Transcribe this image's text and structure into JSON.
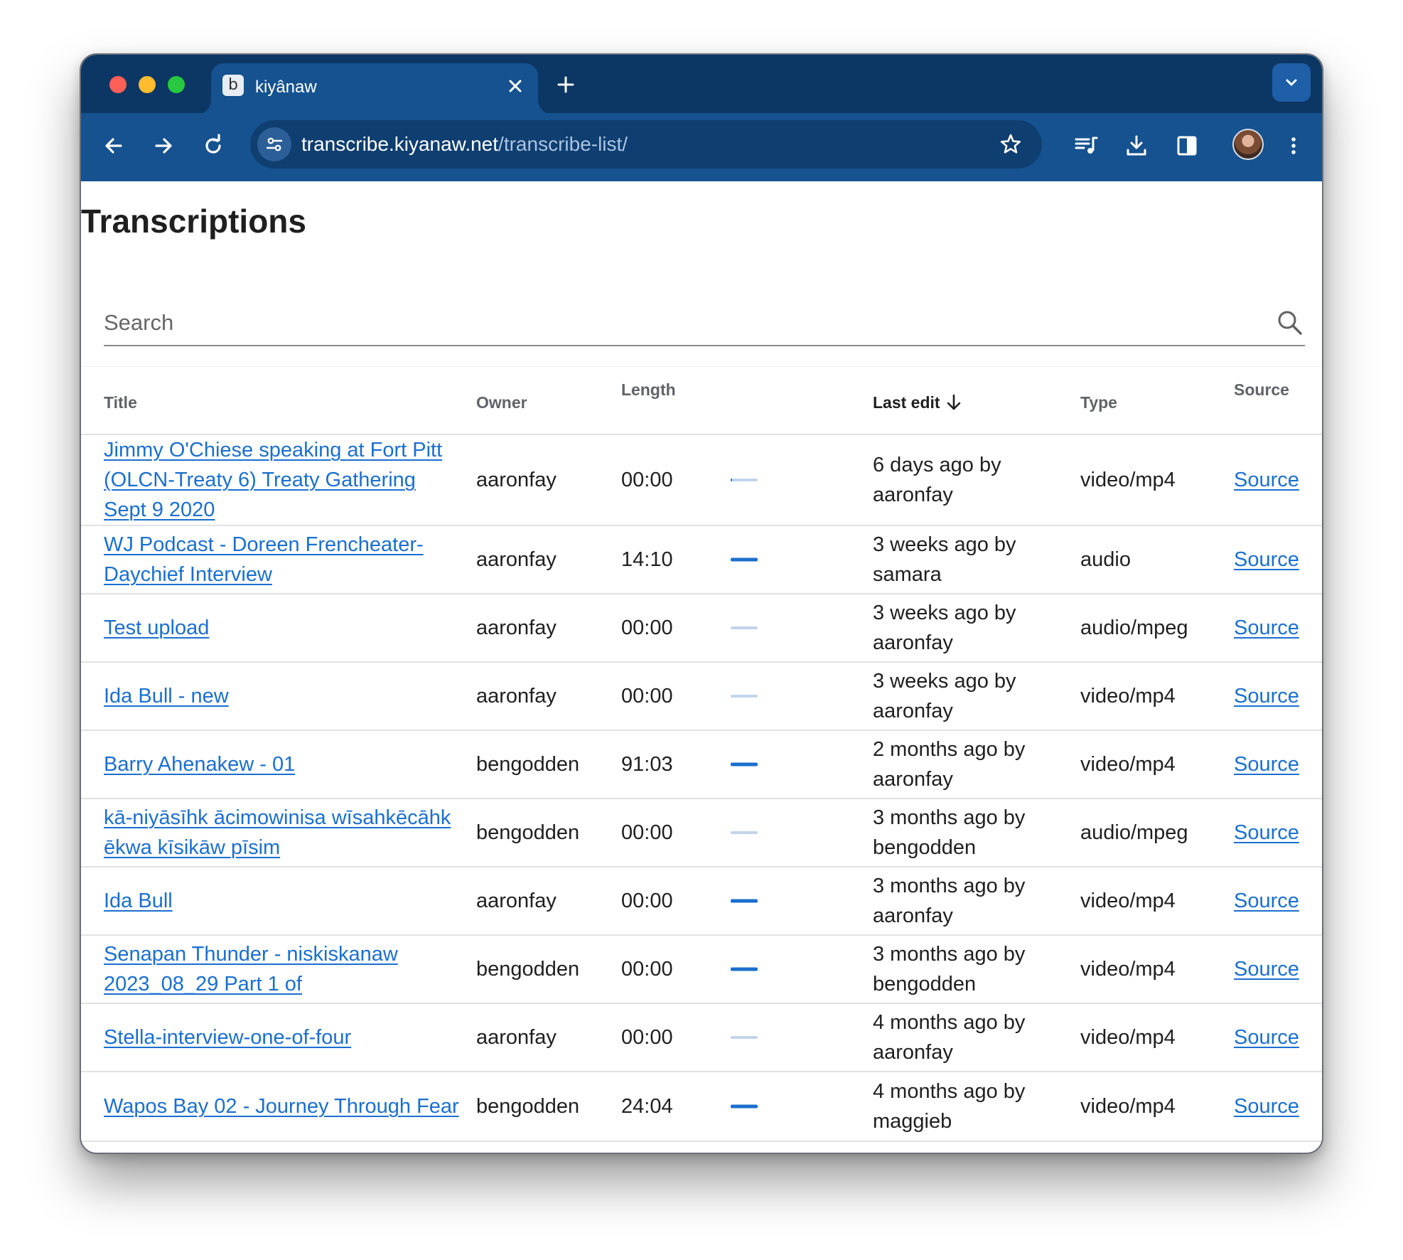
{
  "browser": {
    "tab": {
      "favicon": "b",
      "title": "kiyânaw",
      "close_icon": "close-icon"
    },
    "new_tab_icon": "plus-icon",
    "tab_menu_icon": "chevron-down-icon",
    "toolbar": {
      "back_icon": "arrow-left-icon",
      "forward_icon": "arrow-right-icon",
      "reload_icon": "reload-icon",
      "site_info_icon": "tune-icon",
      "url_host": "transcribe.kiyanaw.net",
      "url_path": "/transcribe-list/",
      "bookmark_icon": "star-icon",
      "media_icon": "playlist-music-icon",
      "download_icon": "download-icon",
      "sidepanel_icon": "side-panel-icon",
      "profile_icon": "avatar",
      "menu_icon": "kebab-menu-icon"
    },
    "colors": {
      "tabstrip": "#0c3764",
      "toolbar": "#15528f",
      "omnibox": "#0f3e70"
    }
  },
  "page": {
    "title": "Transcriptions",
    "search": {
      "placeholder": "Search",
      "value": "",
      "icon": "search-icon"
    },
    "table": {
      "headers": {
        "title": "Title",
        "owner": "Owner",
        "length": "Length",
        "last_edit": "Last edit",
        "type": "Type",
        "source": "Source"
      },
      "sort_icon": "arrow-down-icon",
      "rows": [
        {
          "title": "Jimmy O'Chiese speaking at Fort Pitt (OLCN-Treaty 6) Treaty Gathering Sept 9 2020",
          "owner": "aaronfay",
          "length": "00:00",
          "progress": 0.05,
          "last_edit": "6 days ago by aaronfay",
          "type": "video/mp4",
          "source": "Source"
        },
        {
          "title": "WJ Podcast - Doreen Frencheater-Daychief Interview",
          "owner": "aaronfay",
          "length": "14:10",
          "progress": 1.0,
          "last_edit": "3 weeks ago by samara",
          "type": "audio",
          "source": "Source"
        },
        {
          "title": "Test upload",
          "owner": "aaronfay",
          "length": "00:00",
          "progress": 0.0,
          "last_edit": "3 weeks ago by aaronfay",
          "type": "audio/mpeg",
          "source": "Source"
        },
        {
          "title": "Ida Bull - new",
          "owner": "aaronfay",
          "length": "00:00",
          "progress": 0.0,
          "last_edit": "3 weeks ago by aaronfay",
          "type": "video/mp4",
          "source": "Source"
        },
        {
          "title": "Barry Ahenakew - 01",
          "owner": "bengodden",
          "length": "91:03",
          "progress": 1.0,
          "last_edit": "2 months ago by aaronfay",
          "type": "video/mp4",
          "source": "Source"
        },
        {
          "title": "kā-niyāsīhk ācimowinisa wīsahkēcāhk ēkwa kīsikāw pīsim",
          "owner": "bengodden",
          "length": "00:00",
          "progress": 0.0,
          "last_edit": "3 months ago by bengodden",
          "type": "audio/mpeg",
          "source": "Source"
        },
        {
          "title": "Ida Bull",
          "owner": "aaronfay",
          "length": "00:00",
          "progress": 1.0,
          "last_edit": "3 months ago by aaronfay",
          "type": "video/mp4",
          "source": "Source"
        },
        {
          "title": "Senapan Thunder - niskiskanaw 2023_08_29 Part 1 of",
          "owner": "bengodden",
          "length": "00:00",
          "progress": 1.0,
          "last_edit": "3 months ago by bengodden",
          "type": "video/mp4",
          "source": "Source"
        },
        {
          "title": "Stella-interview-one-of-four",
          "owner": "aaronfay",
          "length": "00:00",
          "progress": 0.0,
          "last_edit": "4 months ago by aaronfay",
          "type": "video/mp4",
          "source": "Source"
        },
        {
          "title": "Wapos Bay 02 - Journey Through Fear",
          "owner": "bengodden",
          "length": "24:04",
          "progress": 1.0,
          "last_edit": "4 months ago by maggieb",
          "type": "video/mp4",
          "source": "Source"
        }
      ]
    },
    "colors": {
      "link": "#1a6fd1",
      "progress_done": "#1b6fce",
      "progress_remaining": "#c3d4ea"
    }
  }
}
